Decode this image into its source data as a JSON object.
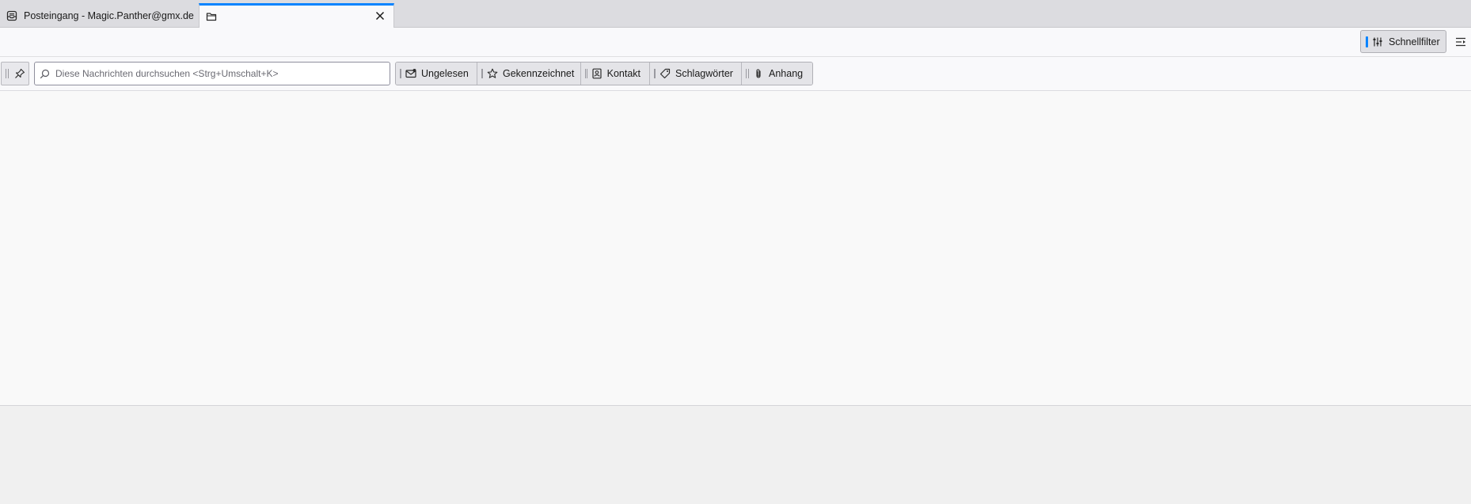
{
  "tabs": [
    {
      "label": "Posteingang - Magic.Panther@gmx.de",
      "icon": "inbox-icon",
      "active": false
    },
    {
      "label": "",
      "icon": "folder-icon",
      "active": true
    }
  ],
  "toolbar": {
    "quick_filter_label": "Schnellfilter",
    "quick_filter_icon": "sliders-icon",
    "layout_icon": "layout-icon"
  },
  "filterbar": {
    "pin_icon": "pin-icon",
    "search": {
      "placeholder": "Diese Nachrichten durchsuchen <Strg+Umschalt+K>",
      "value": ""
    },
    "filters": [
      {
        "label": "Ungelesen",
        "icon": "unread-mail-icon"
      },
      {
        "label": "Gekennzeichnet",
        "icon": "star-icon"
      },
      {
        "label": "Kontakt",
        "icon": "contact-icon"
      },
      {
        "label": "Schlagwörter",
        "icon": "tag-icon"
      },
      {
        "label": "Anhang",
        "icon": "paperclip-icon"
      }
    ]
  },
  "colors": {
    "accent": "#0a84ff",
    "tabbar_bg": "#dcdce0",
    "content_bg": "#f9f9f9"
  }
}
